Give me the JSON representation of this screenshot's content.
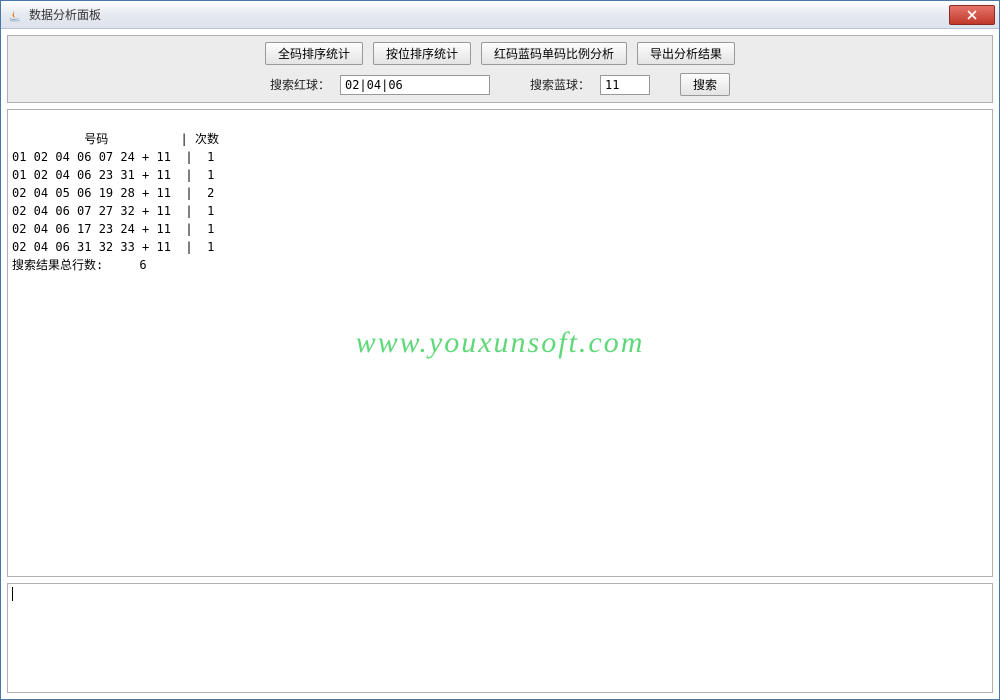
{
  "window": {
    "title": "数据分析面板"
  },
  "toolbar": {
    "buttons": {
      "full_sort": "全码排序统计",
      "pos_sort": "按位排序统计",
      "ratio": "红码蓝码单码比例分析",
      "export": "导出分析结果"
    },
    "search": {
      "red_label": "搜索红球：",
      "red_value": "02|04|06",
      "blue_label": "搜索蓝球：",
      "blue_value": "11",
      "search_btn": "搜索"
    }
  },
  "results": {
    "header": "          号码          | 次数",
    "rows": [
      "01 02 04 06 07 24 + 11  |  1",
      "01 02 04 06 23 31 + 11  |  1",
      "02 04 05 06 19 28 + 11  |  2",
      "02 04 06 07 27 32 + 11  |  1",
      "02 04 06 17 23 24 + 11  |  1",
      "02 04 06 31 32 33 + 11  |  1"
    ],
    "total": "搜索结果总行数:     6"
  },
  "watermark": "www.youxunsoft.com",
  "bottom": ""
}
